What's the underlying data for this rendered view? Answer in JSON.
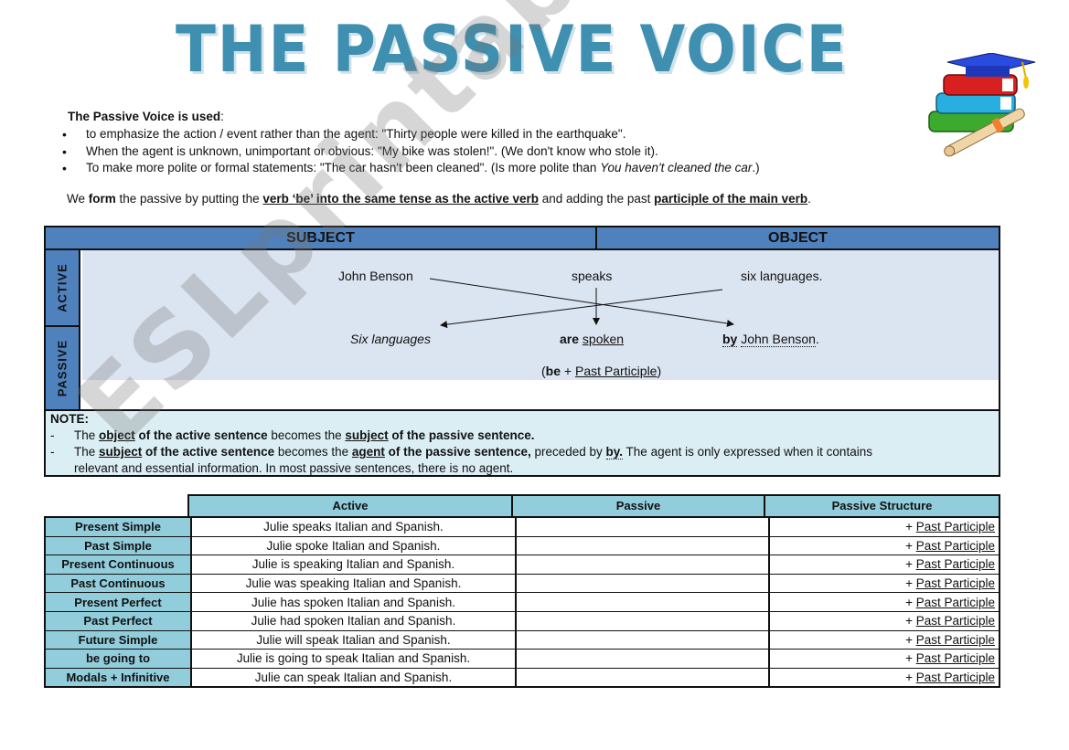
{
  "title": {
    "part1": "The",
    "part2": "Passive",
    "part3": "Voice"
  },
  "illustration": "books-and-graduation-cap-icon",
  "intro": {
    "heading_bold": "The Passive Voice is used",
    "heading_colon": ":",
    "uses": [
      "to emphasize the action / event rather than the agent: \"Thirty people were killed in the earthquake\".",
      "When the agent is unknown, unimportant or obvious: \"My bike was stolen!\". (We don't know who stole it).",
      {
        "text": "To make more polite or formal statements: \"The car hasn't been cleaned\". (Is more polite than ",
        "italic": "You haven't cleaned the car",
        "end": ".)"
      }
    ],
    "form_line": {
      "p1": "We ",
      "b1": "form",
      "p2": " the passive by putting the ",
      "u1": "verb ‘be’ into the same tense as the active verb",
      "p3": " and adding the past ",
      "u2": "participle of the main verb",
      "p4": "."
    }
  },
  "diagram": {
    "header_subject": "SUBJECT",
    "header_object": "OBJECT",
    "side_active": "ACTIVE",
    "side_passive": "PASSIVE",
    "active": {
      "subject": "John Benson",
      "verb": "speaks",
      "object": "six languages."
    },
    "passive": {
      "subject": "Six languages",
      "aux": "are",
      "participle": "spoken",
      "by": "by",
      "agent": "John Benson",
      "agent_end": "."
    },
    "formula": {
      "open": "(",
      "be": "be",
      "plus": " + ",
      "pp": "Past Participle",
      "close": ")"
    }
  },
  "note": {
    "title": "NOTE:",
    "line1": {
      "dash": "-",
      "p1": "The ",
      "u1": "object",
      "b1": " of the active sentence",
      "p2": " becomes the ",
      "u2": "subject",
      "b2": " of the passive sentence."
    },
    "line2": {
      "dash": "-",
      "p1": "The ",
      "u1": "subject",
      "b1": " of the active sentence",
      "p2": " becomes the ",
      "u2": "agent",
      "b2": " of the passive sentence,",
      "p3": " preceded by ",
      "by": "by.",
      "p4": " The agent is only expressed when it contains"
    },
    "line3": "relevant and essential information. In most passive sentences, there is no agent."
  },
  "tense_table": {
    "headers": {
      "active": "Active",
      "passive": "Passive",
      "structure": "Passive Structure"
    },
    "rows": [
      {
        "tense": "Present Simple",
        "active": "Julie speaks Italian and Spanish.",
        "passive": "",
        "plus": "+ ",
        "pp": "Past Participle"
      },
      {
        "tense": "Past Simple",
        "active": "Julie spoke Italian and Spanish.",
        "passive": "",
        "plus": "+ ",
        "pp": "Past Participle"
      },
      {
        "tense": "Present Continuous",
        "active": "Julie is speaking Italian and Spanish.",
        "passive": "",
        "plus": "+ ",
        "pp": "Past Participle"
      },
      {
        "tense": "Past Continuous",
        "active": "Julie was speaking Italian and Spanish.",
        "passive": "",
        "plus": "+ ",
        "pp": "Past Participle"
      },
      {
        "tense": "Present Perfect",
        "active": "Julie has spoken Italian and Spanish.",
        "passive": "",
        "plus": "+ ",
        "pp": "Past Participle"
      },
      {
        "tense": "Past Perfect",
        "active": "Julie had spoken Italian and Spanish.",
        "passive": "",
        "plus": "+ ",
        "pp": "Past Participle"
      },
      {
        "tense": "Future Simple",
        "active": "Julie will speak Italian and Spanish.",
        "passive": "",
        "plus": "+ ",
        "pp": "Past Participle"
      },
      {
        "tense": "be going to",
        "active": "Julie is going to speak Italian and Spanish.",
        "passive": "",
        "plus": "+ ",
        "pp": "Past Participle"
      },
      {
        "tense": "Modals + Infinitive",
        "active": "Julie can speak Italian and Spanish.",
        "passive": "",
        "plus": "+ ",
        "pp": "Past Participle"
      }
    ]
  },
  "watermark": "ESLprintables.com",
  "colors": {
    "title": "#3e8fb0",
    "header_blue": "#4f81bd",
    "diagram_bg": "#dbe4f1",
    "note_bg": "#dbeef4",
    "table_cyan": "#92cddc"
  }
}
